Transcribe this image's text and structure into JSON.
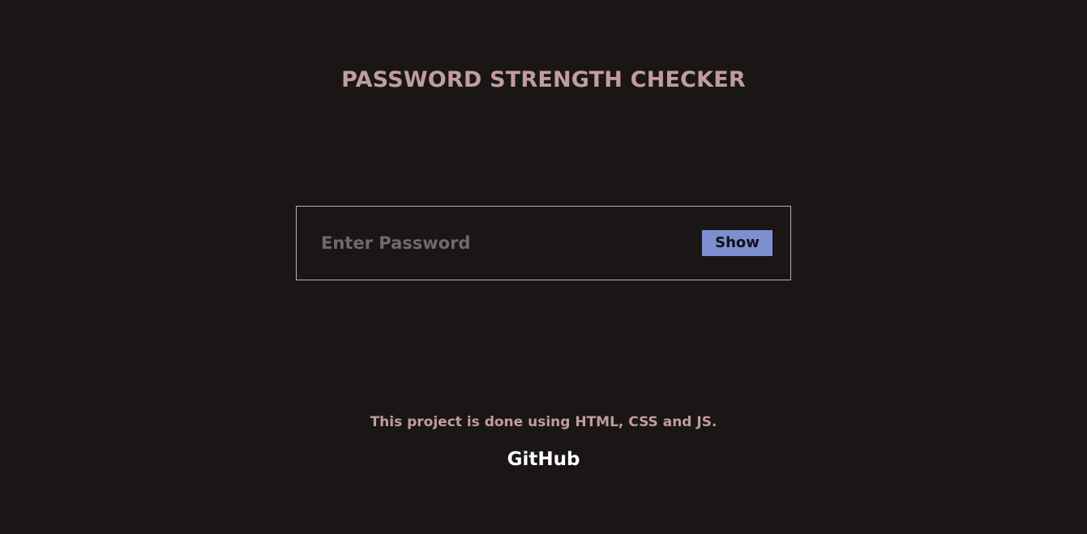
{
  "colors": {
    "background": "#1a1616",
    "accent_text": "#c19c9e",
    "button_bg": "#7b8fd1",
    "link": "#ffffff",
    "border": "#b9b4b4"
  },
  "header": {
    "title": "PASSWORD STRENGTH CHECKER"
  },
  "password_field": {
    "placeholder": "Enter Password",
    "value": "",
    "show_label": "Show"
  },
  "footer": {
    "note": "This project is done using HTML, CSS and JS.",
    "github_label": "GitHub"
  }
}
